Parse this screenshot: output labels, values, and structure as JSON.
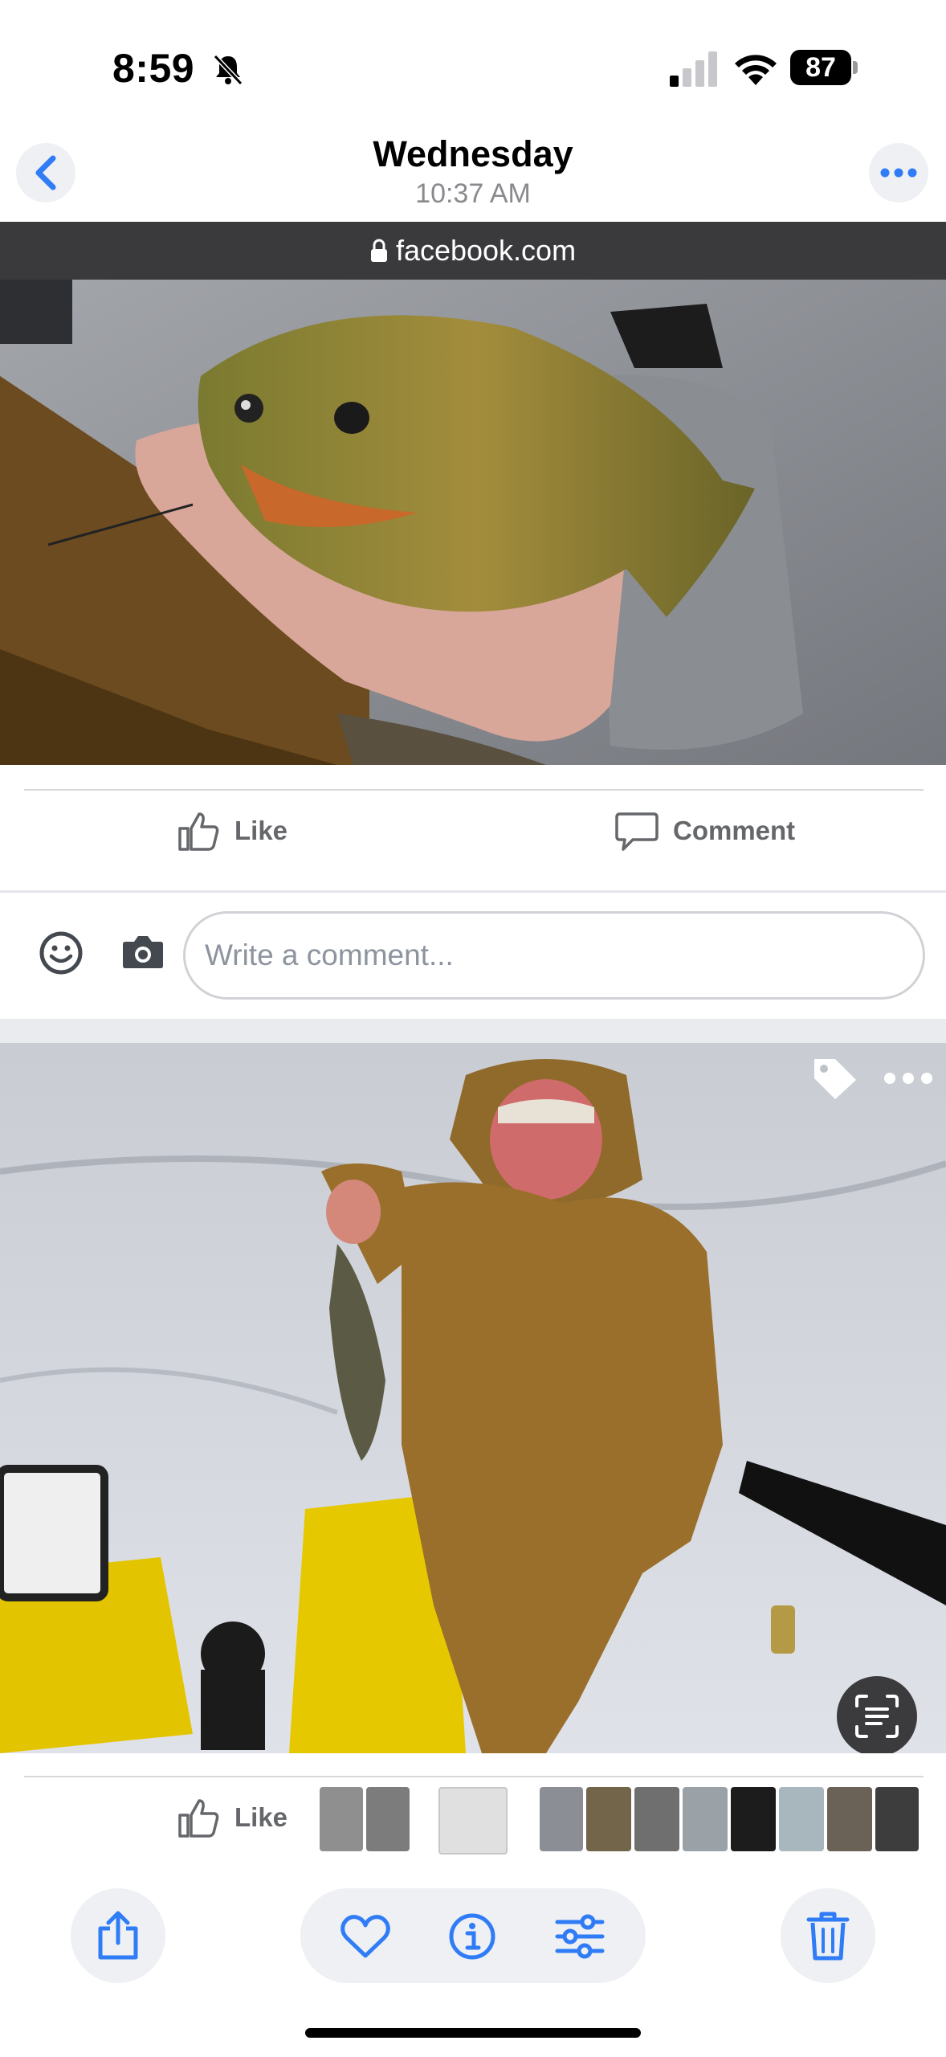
{
  "status_bar": {
    "time": "8:59",
    "battery": "87"
  },
  "header": {
    "title": "Wednesday",
    "subtitle": "10:37 AM"
  },
  "url_bar": {
    "domain": "facebook.com"
  },
  "post1": {
    "like_label": "Like",
    "comment_label": "Comment"
  },
  "comment_input": {
    "placeholder": "Write a comment..."
  },
  "post2": {
    "like_label": "Like"
  },
  "colors": {
    "accent": "#1877f2",
    "icon_blue": "#2f7cf6"
  },
  "toolbar": {
    "share": "share-icon",
    "favorite": "heart-icon",
    "info": "info-icon",
    "adjust": "adjust-icon",
    "delete": "trash-icon"
  }
}
